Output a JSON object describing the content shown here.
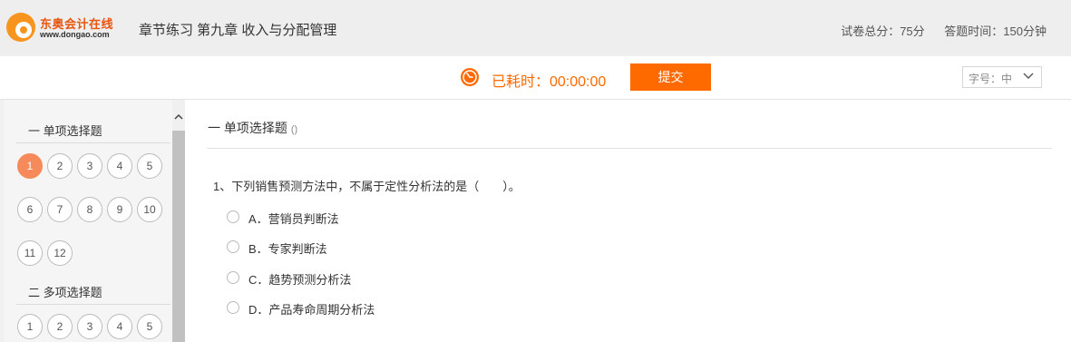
{
  "header": {
    "logo_cn": "东奥会计在线",
    "logo_url": "www.dongao.com",
    "title": "章节练习 第九章 收入与分配管理",
    "total_score": "试卷总分：75分",
    "time_limit": "答题时间：150分钟"
  },
  "toolbar": {
    "elapsed": "已耗时：00:00:00",
    "submit_label": "提交",
    "font_size_label": "字号：中"
  },
  "sidebar": {
    "sections": [
      {
        "title": "一 单项选择题",
        "numbers": [
          "1",
          "2",
          "3",
          "4",
          "5",
          "6",
          "7",
          "8",
          "9",
          "10",
          "11",
          "12"
        ],
        "active": "1"
      },
      {
        "title": "二 多项选择题",
        "numbers": [
          "1",
          "2",
          "3",
          "4",
          "5"
        ]
      }
    ]
  },
  "main": {
    "section_title": "一 单项选择题",
    "section_paren": "()",
    "question": "1、下列销售预测方法中，不属于定性分析法的是（　　）。",
    "options": [
      "A．营销员判断法",
      "B．专家判断法",
      "C．趋势预测分析法",
      "D．产品寿命周期分析法"
    ]
  },
  "colors": {
    "accent": "#ff6a00",
    "active_number": "#f78a5a"
  }
}
